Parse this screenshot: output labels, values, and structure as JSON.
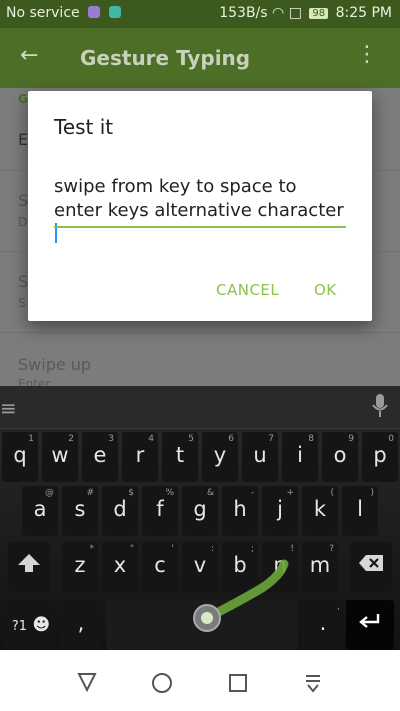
{
  "status_bar": {
    "carrier": "No service",
    "speed": "153B/s",
    "battery": "98",
    "time": "8:25 PM"
  },
  "app_bar": {
    "title": "Gesture Typing",
    "back_icon": "arrow-back-icon",
    "more_icon": "more-vert-icon"
  },
  "settings": {
    "section_letter": "G",
    "row1_letter": "E",
    "row2_letter": "S",
    "row2_sub": "D",
    "row3_letter": "S",
    "row3_sub": "S",
    "row4_title": "Swipe up",
    "row4_sub": "Enter"
  },
  "dialog": {
    "title": "Test it",
    "text": "swipe from key to space to enter keys alternative character",
    "cancel": "CANCEL",
    "ok": "OK"
  },
  "colors": {
    "accent": "#8bc34a",
    "appbar": "#4d6e27",
    "statusbar": "#3c5a1e",
    "caret": "#2196f3"
  },
  "keyboard": {
    "row1": [
      {
        "k": "q",
        "h": "1"
      },
      {
        "k": "w",
        "h": "2"
      },
      {
        "k": "e",
        "h": "3"
      },
      {
        "k": "r",
        "h": "4"
      },
      {
        "k": "t",
        "h": "5"
      },
      {
        "k": "y",
        "h": "6"
      },
      {
        "k": "u",
        "h": "7"
      },
      {
        "k": "i",
        "h": "8"
      },
      {
        "k": "o",
        "h": "9"
      },
      {
        "k": "p",
        "h": "0"
      }
    ],
    "row2": [
      {
        "k": "a",
        "h": "@"
      },
      {
        "k": "s",
        "h": "#"
      },
      {
        "k": "d",
        "h": "$"
      },
      {
        "k": "f",
        "h": "%"
      },
      {
        "k": "g",
        "h": "&"
      },
      {
        "k": "h",
        "h": "-"
      },
      {
        "k": "j",
        "h": "+"
      },
      {
        "k": "k",
        "h": "("
      },
      {
        "k": "l",
        "h": ")"
      }
    ],
    "row3": [
      {
        "k": "z",
        "h": "*"
      },
      {
        "k": "x",
        "h": "\""
      },
      {
        "k": "c",
        "h": "'"
      },
      {
        "k": "v",
        "h": ":"
      },
      {
        "k": "b",
        "h": ";"
      },
      {
        "k": "n",
        "h": "!"
      },
      {
        "k": "m",
        "h": "?"
      }
    ],
    "symbols_label": "?1",
    "comma": ",",
    "period": ".",
    "period_hint": ",",
    "enter_icon": "enter-icon",
    "shift_icon": "shift-icon",
    "delete_icon": "backspace-icon",
    "menu_icon": "menu-icon",
    "mic_icon": "mic-icon"
  },
  "nav": {
    "back_icon": "nav-back-icon",
    "home_icon": "nav-home-icon",
    "recents_icon": "nav-recents-icon",
    "notif_icon": "nav-pull-down-icon"
  }
}
